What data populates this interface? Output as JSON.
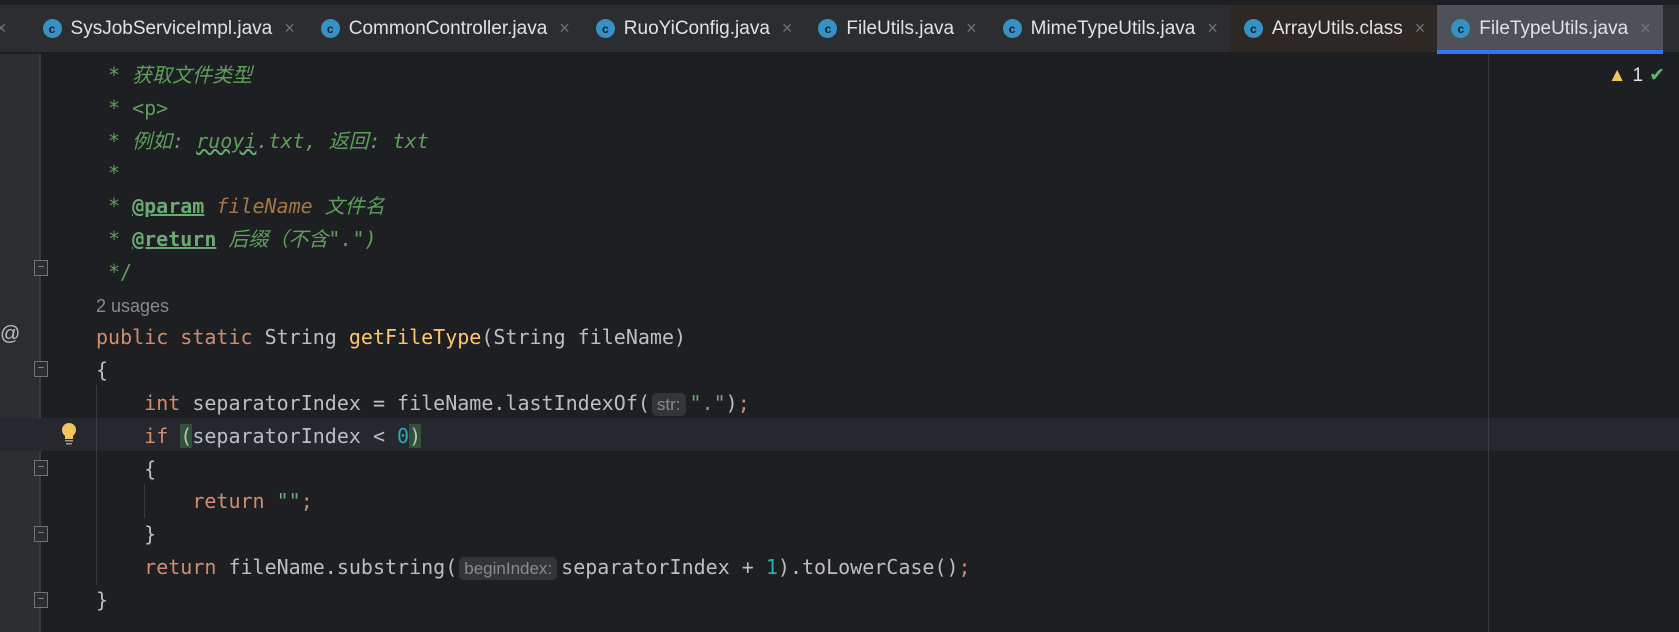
{
  "tabs": [
    {
      "label": "SysJobServiceImpl.java",
      "type": "java",
      "state": "normal"
    },
    {
      "label": "CommonController.java",
      "type": "java",
      "state": "normal"
    },
    {
      "label": "RuoYiConfig.java",
      "type": "java",
      "state": "normal"
    },
    {
      "label": "FileUtils.java",
      "type": "java",
      "state": "normal"
    },
    {
      "label": "MimeTypeUtils.java",
      "type": "java",
      "state": "normal"
    },
    {
      "label": "ArrayUtils.class",
      "type": "class",
      "state": "normal"
    },
    {
      "label": "FileTypeUtils.java",
      "type": "java",
      "state": "active"
    }
  ],
  "tab_icon_letter": "c",
  "close_glyph": "×",
  "status": {
    "warnings": "1"
  },
  "gutter": {
    "at_marker": "@"
  },
  "code": [
    [
      [
        "* ",
        "cmn"
      ],
      [
        "获取文件类型",
        "cm"
      ]
    ],
    [
      [
        "* ",
        "cmn"
      ],
      [
        "<p>",
        "cmn"
      ]
    ],
    [
      [
        "* ",
        "cmn"
      ],
      [
        "例如: ",
        "cm"
      ],
      [
        "ruoyi",
        "cm typo"
      ],
      [
        ".txt, ",
        "cm"
      ],
      [
        "返回: ",
        "cm"
      ],
      [
        "txt",
        "cm"
      ]
    ],
    [
      [
        "*",
        "cmn"
      ]
    ],
    [
      [
        "* ",
        "cmn"
      ],
      [
        "@param",
        "tag"
      ],
      [
        " ",
        ""
      ],
      [
        "fileName",
        "pn"
      ],
      [
        " 文件名",
        "cm"
      ]
    ],
    [
      [
        "* ",
        "cmn"
      ],
      [
        "@return",
        "tag"
      ],
      [
        " 后缀（不含\".\")",
        "cm"
      ]
    ],
    [
      [
        "*/",
        "cmn"
      ]
    ],
    [
      [
        "2 usages",
        "us"
      ]
    ],
    [
      [
        "public ",
        "kw"
      ],
      [
        "static ",
        "kw"
      ],
      [
        "String ",
        ""
      ],
      [
        "getFileType",
        "fn"
      ],
      [
        "(String fileName)",
        ""
      ]
    ],
    [
      [
        "{",
        ""
      ]
    ],
    [
      [
        "    ",
        ""
      ],
      [
        "int ",
        "kw"
      ],
      [
        "separatorIndex = fileName.lastIndexOf(",
        ""
      ],
      [
        "str:",
        "hint"
      ],
      [
        "\".\"",
        "str"
      ],
      [
        ")",
        ""
      ],
      [
        ";",
        "kw"
      ]
    ],
    [
      [
        "    ",
        ""
      ],
      [
        "if ",
        "kw"
      ],
      [
        "(",
        "br"
      ],
      [
        "separatorIndex < ",
        ""
      ],
      [
        "0",
        "num"
      ],
      [
        ")",
        "br"
      ]
    ],
    [
      [
        "    {",
        ""
      ]
    ],
    [
      [
        "        ",
        ""
      ],
      [
        "return ",
        "kw"
      ],
      [
        "\"\"",
        "str"
      ],
      [
        ";",
        "kw"
      ]
    ],
    [
      [
        "    }",
        ""
      ]
    ],
    [
      [
        "    ",
        ""
      ],
      [
        "return ",
        "kw"
      ],
      [
        "fileName.substring(",
        ""
      ],
      [
        "beginIndex:",
        "hint"
      ],
      [
        "separatorIndex + ",
        ""
      ],
      [
        "1",
        "num"
      ],
      [
        ").toLowerCase()",
        ""
      ],
      [
        ";",
        "kw"
      ]
    ],
    [
      [
        "}",
        ""
      ]
    ]
  ]
}
